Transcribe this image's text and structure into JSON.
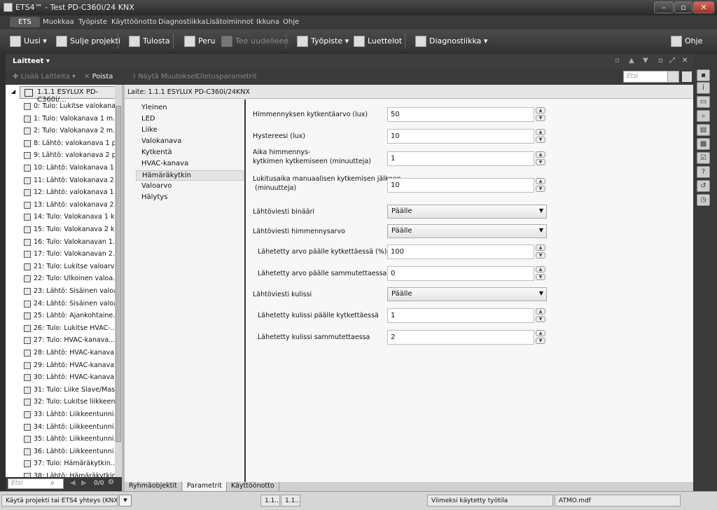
{
  "window": {
    "title": "ETS4™ - Test PD-C360i/24 KNX",
    "minimize": "–",
    "maximize": "▫",
    "close": "✕"
  },
  "menu": [
    "ETS",
    "Muokkaa",
    "Työpiste",
    "Käyttöönotto",
    "Diagnostiikka",
    "Lisätoiminnot",
    "Ikkuna",
    "Ohje"
  ],
  "toolbar": {
    "new": "Uusi",
    "close_project": "Sulje projekti",
    "print": "Tulosta",
    "undo": "Peru",
    "redo": "Tee uudelleen",
    "workspace": "Työpiste",
    "catalogs": "Luettelot",
    "diagnostics": "Diagnostiikka",
    "help": "Ohje"
  },
  "panel": {
    "title": "Laitteet",
    "add_devices": "Lisää Laitteita",
    "delete": "Poista",
    "show_changes": "Näytä Muutokset",
    "default_params": "Oletusparametrit",
    "search_placeholder": "Etsi"
  },
  "tree": {
    "root": "1.1.1  ESYLUX PD-C360i/...",
    "items": [
      "0: Tulo: Lukitse valokana...",
      "1: Tulo: Valokanava 1 m...",
      "2: Tulo: Valokanava 2 m...",
      "8: Lähtö: valokanava 1 p...",
      "9: Lähtö: valokanava 2 p...",
      "10: Lähtö: Valokanava 1...",
      "11: Lähtö: Valokanava 2...",
      "12: Lähtö: valokanava 1...",
      "13: Lähtö: valokanava 2...",
      "14: Tulo: Valokanava 1 k...",
      "15: Tulo: Valokanava 2 k...",
      "16: Tulo: Valokanavan 1...",
      "17: Tulo: Valokanavan 2...",
      "21: Tulo: Lukitse valoarv...",
      "22: Tulo: Ulkoinen valoa...",
      "23: Lähtö: Sisäinen valoa...",
      "24: Lähtö: Sisäinen valoa...",
      "25: Lähtö: Ajankohtaine...",
      "26: Tulo: Lukitse HVAC-...",
      "27: Tulo: HVAC-kanava...",
      "28: Lähtö: HVAC-kanava...",
      "29: Lähtö: HVAC-kanava...",
      "30: Lähtö: HVAC-kanava...",
      "31: Tulo: Liike Slave/Mas...",
      "32: Tulo: Lukitse liikkeen...",
      "33: Lähtö: Liikkeentunni...",
      "34: Lähtö: Liikkeentunni...",
      "35: Lähtö: Liikkeentunni...",
      "36: Lähtö: Liikkeentunni...",
      "37: Tulo: Hämäräkytkin...",
      "38: Lähtö: Hämäräkytkin"
    ],
    "search_placeholder": "Etsi",
    "page": "0/0"
  },
  "detail": {
    "header": "Laite: 1.1.1  ESYLUX PD-C360i/24KNX",
    "categories": [
      "Yleinen",
      "LED",
      "Liike",
      "Valokanava",
      "Kytkentä",
      "HVAC-kanava",
      "Hämäräkytkin",
      "Valoarvo",
      "Hälytys"
    ],
    "params": [
      {
        "label": "Himmennyksen kytkentäarvo (lux)",
        "value": "50"
      },
      {
        "label": "Hystereesi (lux)",
        "value": "10"
      },
      {
        "label": "Aika himmennys-\nkytkimen kytkemiseen (minuutteja)",
        "value": "1"
      },
      {
        "label": "Lukitusaika manuaalisen kytkemisen jälkeen\n (minuutteja)",
        "value": "10"
      },
      {
        "label": "Lähtöviesti binääri",
        "value": "Päälle"
      },
      {
        "label": "Lähtöviesti himmennysarvo",
        "value": "Päälle"
      },
      {
        "label": "Lähetetty arvo päälle kytkettäessä (%)",
        "value": "100"
      },
      {
        "label": "Lähetetty arvo päälle sammutettaessa (%)",
        "value": "0"
      },
      {
        "label": "Lähtöviesti kulissi",
        "value": "Päälle"
      },
      {
        "label": "Lähetetty kulissi päälle kytkettäessä",
        "value": "1"
      },
      {
        "label": "Lähetetty kulissi sammutettaessa",
        "value": "2"
      }
    ],
    "tabs": [
      "Ryhmäobjektit",
      "Parametrit",
      "Käyttöönotto"
    ]
  },
  "status": {
    "project": "Käytä projekti tai ETS4 yhteys (KNX...",
    "addr1": "1.1...",
    "addr2": "1.1...",
    "last_used": "Viimeksi käytetty työtila",
    "file": "ATMO.mdf"
  }
}
